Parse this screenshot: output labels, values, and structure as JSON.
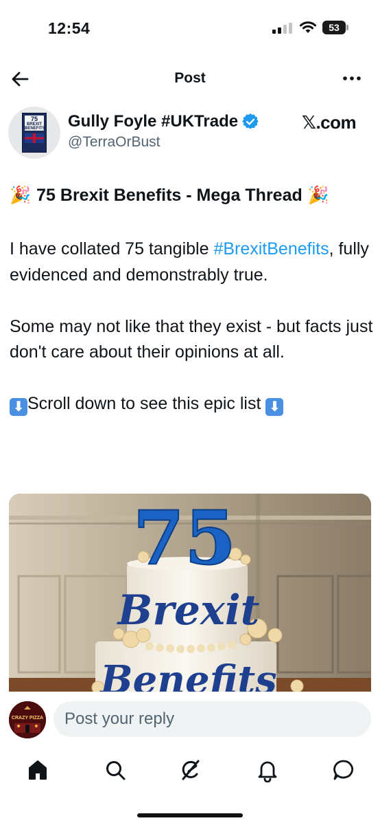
{
  "status_bar": {
    "time": "12:54",
    "battery": "53"
  },
  "header": {
    "title": "Post",
    "back_icon": "arrow-left-icon",
    "more_icon": "more-horizontal-icon"
  },
  "author": {
    "name": "Gully Foyle #UKTrade",
    "handle": "@TerraOrBust",
    "verified": true,
    "avatar_book_number": "75",
    "avatar_book_line1": "BREXIT",
    "avatar_book_line2": "BENEFITS"
  },
  "source_label": "𝕏.com",
  "post": {
    "title": "75 Brexit Benefits - Mega Thread",
    "title_emoji": "🎉",
    "paragraph1_pre": "I have collated 75 tangible ",
    "paragraph1_hashtag": "#BrexitBenefits",
    "paragraph1_post": ", fully evidenced and demonstrably true.",
    "paragraph2": "Some may not like that they exist - but facts just don't care about their opinions at all.",
    "paragraph3": "Scroll down to see this epic list",
    "arrow_emoji": "⬇"
  },
  "media": {
    "cake_number": "75",
    "cake_word1": "Brexit",
    "cake_word2": "Benefits"
  },
  "reply": {
    "placeholder": "Post your reply",
    "avatar_text": "CRAZY PIZZA"
  },
  "nav": {
    "items": [
      "home-icon",
      "search-icon",
      "grok-icon",
      "notifications-icon",
      "messages-icon"
    ]
  },
  "colors": {
    "accent": "#1d9bf0",
    "cake_blue": "#1a63c4"
  }
}
